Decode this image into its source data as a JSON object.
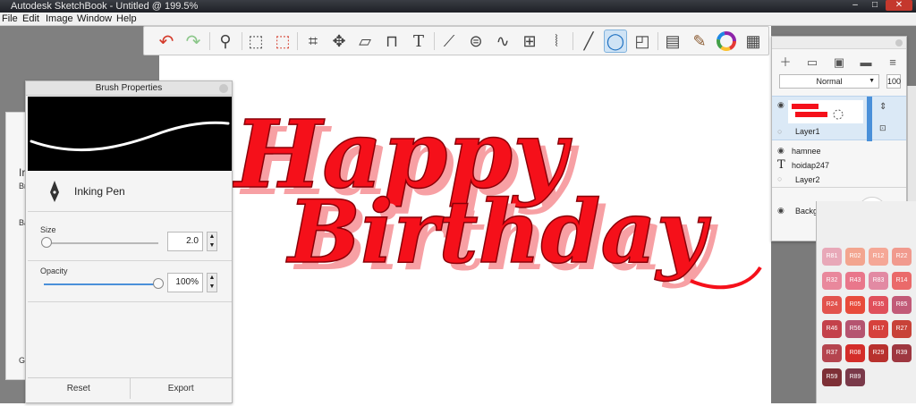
{
  "window": {
    "title": "Autodesk SketchBook - Untitled @ 199.5%",
    "minimize": "–",
    "maximize": "□",
    "close": "✕"
  },
  "menu": [
    "File",
    "Edit",
    "Image",
    "Window",
    "Help"
  ],
  "toolbar": {
    "tools": [
      {
        "name": "undo-icon",
        "glyph": "↶"
      },
      {
        "name": "redo-icon",
        "glyph": "↷"
      },
      {
        "name": "zoom-icon",
        "glyph": "⚲"
      },
      {
        "name": "select-icon",
        "glyph": "⬚"
      },
      {
        "name": "lasso-select-icon",
        "glyph": "⬚"
      },
      {
        "name": "crop-icon",
        "glyph": "⌗"
      },
      {
        "name": "move-icon",
        "glyph": "✥"
      },
      {
        "name": "distort-icon",
        "glyph": "▱"
      },
      {
        "name": "fill-icon",
        "glyph": "⊓"
      },
      {
        "name": "text-icon",
        "glyph": "T"
      },
      {
        "name": "ruler-icon",
        "glyph": "⟋"
      },
      {
        "name": "ellipse-guide-icon",
        "glyph": "⊜"
      },
      {
        "name": "french-curve-icon",
        "glyph": "∿"
      },
      {
        "name": "perspective-icon",
        "glyph": "⊞"
      },
      {
        "name": "symmetry-icon",
        "glyph": "⦚"
      },
      {
        "name": "line-icon",
        "glyph": "╱"
      },
      {
        "name": "ellipse-icon",
        "glyph": "◯"
      },
      {
        "name": "shapes-icon",
        "glyph": "◰"
      },
      {
        "name": "layers-toggle-icon",
        "glyph": "▤"
      },
      {
        "name": "brush-library-icon",
        "glyph": "✎"
      },
      {
        "name": "color-wheel-icon",
        "glyph": "◉"
      },
      {
        "name": "palette-icon",
        "glyph": "▦"
      }
    ],
    "active_tool": "ellipse-icon"
  },
  "brush_panel": {
    "title": "Brush Properties",
    "brush_name": "Inking Pen",
    "size_label": "Size",
    "size_value": "2.0",
    "size_fraction": 0.02,
    "opacity_label": "Opacity",
    "opacity_value": "100%",
    "opacity_fraction": 1.0,
    "reset": "Reset",
    "export": "Export"
  },
  "left_panel_peek": {
    "a": "Ir",
    "b": "Br",
    "c": "Bas",
    "d": "Glo"
  },
  "canvas": {
    "line1": "Happy",
    "line2": "Birthday",
    "ink_color": "#f5101a",
    "shadow_color": "#f7a0a4"
  },
  "layer_panel": {
    "blend_mode": "Normal",
    "opacity": "100",
    "layers": [
      {
        "name": "Layer1"
      },
      {
        "name": "hamnee"
      },
      {
        "name": "hoidap247"
      },
      {
        "name": "Layer2"
      },
      {
        "name": "Background"
      }
    ]
  },
  "swatches": [
    {
      "label": "R81",
      "color": "#e8a8b8"
    },
    {
      "label": "R02",
      "color": "#f3a58f"
    },
    {
      "label": "R12",
      "color": "#f5a796"
    },
    {
      "label": "R22",
      "color": "#f19a8e"
    },
    {
      "label": "R32",
      "color": "#e9889c"
    },
    {
      "label": "R43",
      "color": "#e9778b"
    },
    {
      "label": "R83",
      "color": "#e28aa3"
    },
    {
      "label": "R14",
      "color": "#ea6a6a"
    },
    {
      "label": "R24",
      "color": "#e2534d"
    },
    {
      "label": "R05",
      "color": "#e84b3b"
    },
    {
      "label": "R35",
      "color": "#e0505b"
    },
    {
      "label": "R85",
      "color": "#c25a78"
    },
    {
      "label": "R46",
      "color": "#c4414a"
    },
    {
      "label": "R56",
      "color": "#b55470"
    },
    {
      "label": "R17",
      "color": "#d6413c"
    },
    {
      "label": "R27",
      "color": "#c84238"
    },
    {
      "label": "R37",
      "color": "#b5454f"
    },
    {
      "label": "R08",
      "color": "#d42d2a"
    },
    {
      "label": "R29",
      "color": "#b8312e"
    },
    {
      "label": "R39",
      "color": "#9e3740"
    },
    {
      "label": "R59",
      "color": "#7e3036"
    },
    {
      "label": "R89",
      "color": "#7a3a4a"
    }
  ]
}
